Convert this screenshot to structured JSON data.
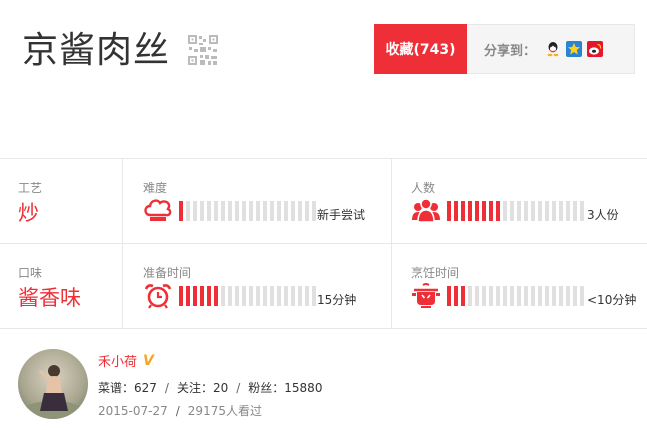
{
  "recipe": {
    "title": "京酱肉丝"
  },
  "actions": {
    "favorite_label": "收藏(743)",
    "share_label": "分享到："
  },
  "share_icons": [
    "qq-icon",
    "qzone-icon",
    "weibo-icon"
  ],
  "colors": {
    "accent": "#ee2f37",
    "bar_off": "#e0e0e0",
    "badge": "#f5a623"
  },
  "attributes": {
    "craft": {
      "label": "工艺",
      "value": "炒"
    },
    "flavor": {
      "label": "口味",
      "value": "酱香味"
    },
    "difficulty": {
      "label": "难度",
      "text": "新手尝试",
      "icon": "chef-hat-icon",
      "level": 1,
      "total": 20
    },
    "servings": {
      "label": "人数",
      "text": "3人份",
      "icon": "people-icon",
      "level": 8,
      "total": 20
    },
    "prep_time": {
      "label": "准备时间",
      "text": "15分钟",
      "icon": "alarm-clock-icon",
      "level": 6,
      "total": 20
    },
    "cook_time": {
      "label": "烹饪时间",
      "text": "<10分钟",
      "icon": "pot-icon",
      "level": 3,
      "total": 20
    }
  },
  "author": {
    "name": "禾小荷",
    "verified": "V",
    "recipes": "菜谱：627",
    "following": "关注：20",
    "fans": "粉丝：15880",
    "date": "2015-07-27",
    "views": "29175人看过"
  }
}
